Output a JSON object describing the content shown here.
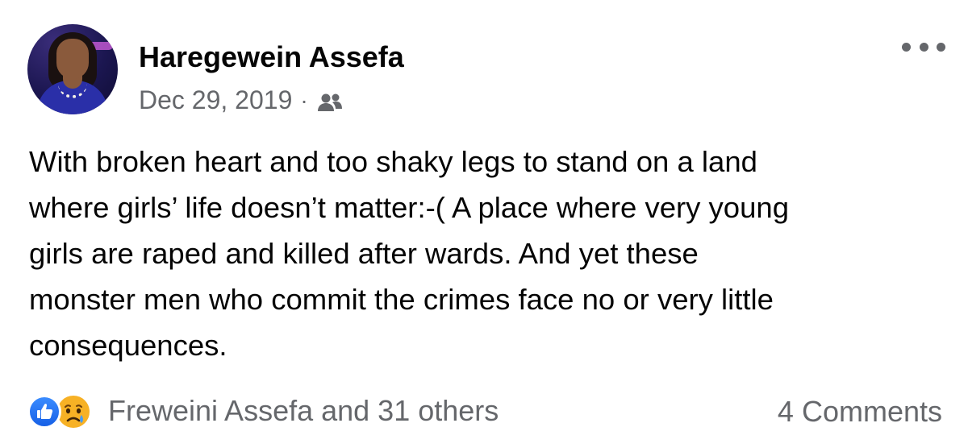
{
  "post": {
    "author": {
      "name": "Haregewein Assefa"
    },
    "date": "Dec 29, 2019",
    "separator": "·",
    "audience_icon": "friends-icon",
    "more_icon": "more-options-icon",
    "text_lines": [
      "With broken heart and too shaky legs to stand on a land",
      "where girls’ life doesn’t matter:-( A place where very young",
      "girls are raped and killed after wards. And yet these",
      "monster men who commit the crimes face no or very little",
      "consequences."
    ]
  },
  "footer": {
    "reaction_icons": [
      "like-icon",
      "sad-icon"
    ],
    "reactions_text": "Freweini Assefa and 31 others",
    "comments_text": "4 Comments"
  },
  "colors": {
    "primary_text": "#050505",
    "secondary_text": "#65676b",
    "like_blue": "#1877f2",
    "sad_yellow": "#f7b125"
  }
}
